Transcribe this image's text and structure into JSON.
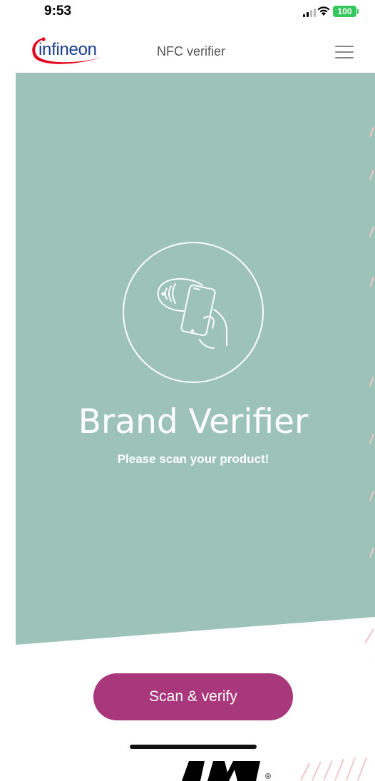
{
  "status_bar": {
    "time": "9:53",
    "battery": "100"
  },
  "header": {
    "logo_text": "infineon",
    "title": "NFC verifier",
    "menu_icon": "hamburger-menu-icon"
  },
  "hero": {
    "icon": "nfc-phone-scan-icon",
    "title": "Brand Verifier",
    "subtitle": "Please scan your product!",
    "background_color": "#9dc3b8"
  },
  "actions": {
    "scan_button_label": "Scan & verify",
    "button_color": "#a8377c"
  }
}
